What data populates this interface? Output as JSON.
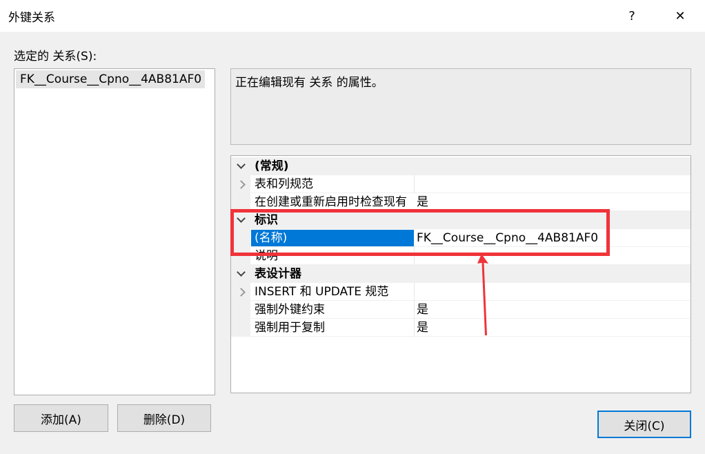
{
  "window": {
    "title": "外键关系",
    "help": "?",
    "close": "✕"
  },
  "left": {
    "label": "选定的 关系(S):",
    "items": [
      "FK__Course__Cpno__4AB81AF0"
    ]
  },
  "description": "正在编辑现有 关系 的属性。",
  "grid": {
    "cat_general": "(常规)",
    "table_column_spec": "表和列规范",
    "check_existing": "在创建或重新启用时检查现有",
    "check_existing_value": "是",
    "cat_identity": "标识",
    "name_label": "(名称)",
    "name_value": "FK__Course__Cpno__4AB81AF0",
    "desc_label": "说明",
    "cat_designer": "表设计器",
    "insert_update": "INSERT 和 UPDATE 规范",
    "enforce_fk": "强制外键约束",
    "enforce_fk_value": "是",
    "enforce_repl": "强制用于复制",
    "enforce_repl_value": "是"
  },
  "buttons": {
    "add": "添加(A)",
    "delete": "删除(D)",
    "close": "关闭(C)"
  },
  "colors": {
    "selection": "#0078d7",
    "annotation": "#f0333a"
  }
}
